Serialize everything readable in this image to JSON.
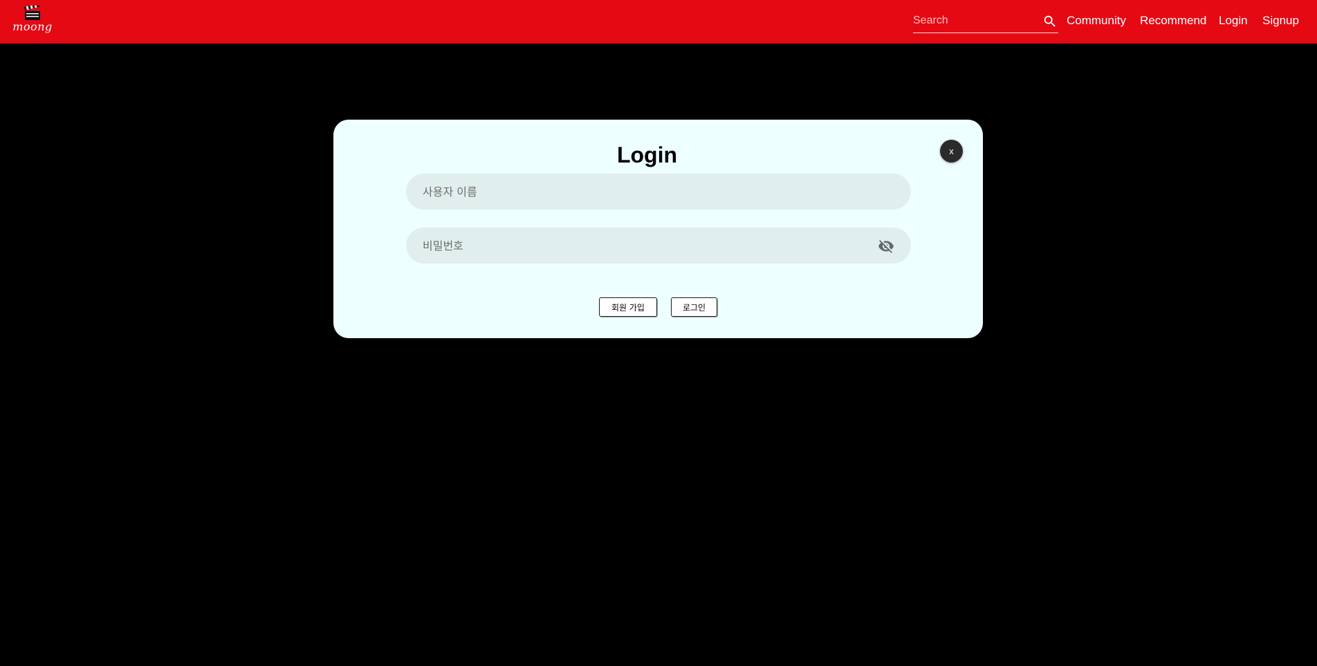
{
  "navbar": {
    "brand": "moong",
    "search_placeholder": "Search",
    "links": {
      "community": "Community",
      "recommend": "Recommend",
      "login": "Login",
      "signup": "Signup"
    },
    "background_color": "#e50914"
  },
  "modal": {
    "title": "Login",
    "close_label": "x",
    "username_placeholder": "사용자 이름",
    "password_placeholder": "비밀번호",
    "signup_button": "회원 가입",
    "login_button": "로그인",
    "background_color": "#eeffff"
  },
  "icons": {
    "logo": "clapperboard-icon",
    "search": "search-icon",
    "password_visibility": "eye-off-icon"
  }
}
